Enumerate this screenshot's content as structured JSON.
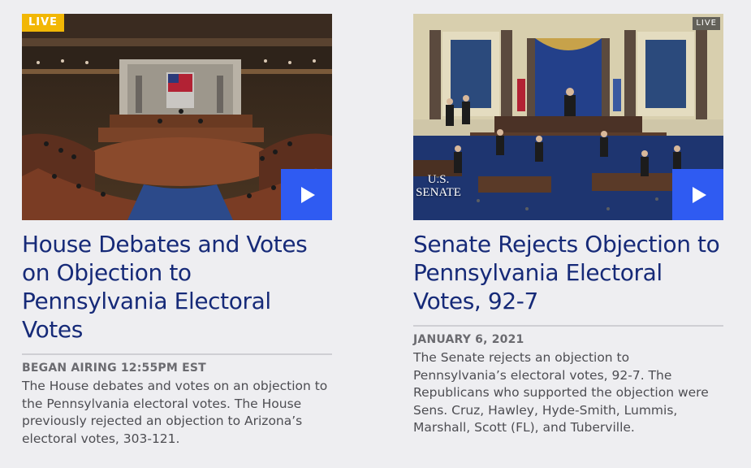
{
  "cards": [
    {
      "live_badge": "LIVE",
      "title": "House Debates and Votes on Objection to Pennsylvania Electoral Votes",
      "meta": "BEGAN AIRING 12:55PM EST",
      "description": "The House debates and votes on an objection to the Pennsylvania electoral votes. The House previously rejected an objection to Arizona’s electoral votes, 303-121.",
      "play_icon": "play-icon"
    },
    {
      "live_badge": "LIVE",
      "senate_logo_line1": "U.S.",
      "senate_logo_line2": "SENATE",
      "title": "Senate Rejects Objection to Pennsylvania Electoral Votes, 92-7",
      "meta": "JANUARY 6, 2021",
      "description": "The Senate rejects an objection to Pennsylvania’s electoral votes, 92-7. The Republicans who supported the objection were Sens. Cruz, Hawley, Hyde-Smith, Lummis, Marshall, Scott (FL), and Tuberville.",
      "play_icon": "play-icon"
    }
  ],
  "colors": {
    "background": "#eeeef1",
    "title": "#162a78",
    "live_badge": "#f2b705",
    "play_button": "#2f5bf2",
    "meta": "#6b6b70",
    "description": "#4d4d52"
  }
}
